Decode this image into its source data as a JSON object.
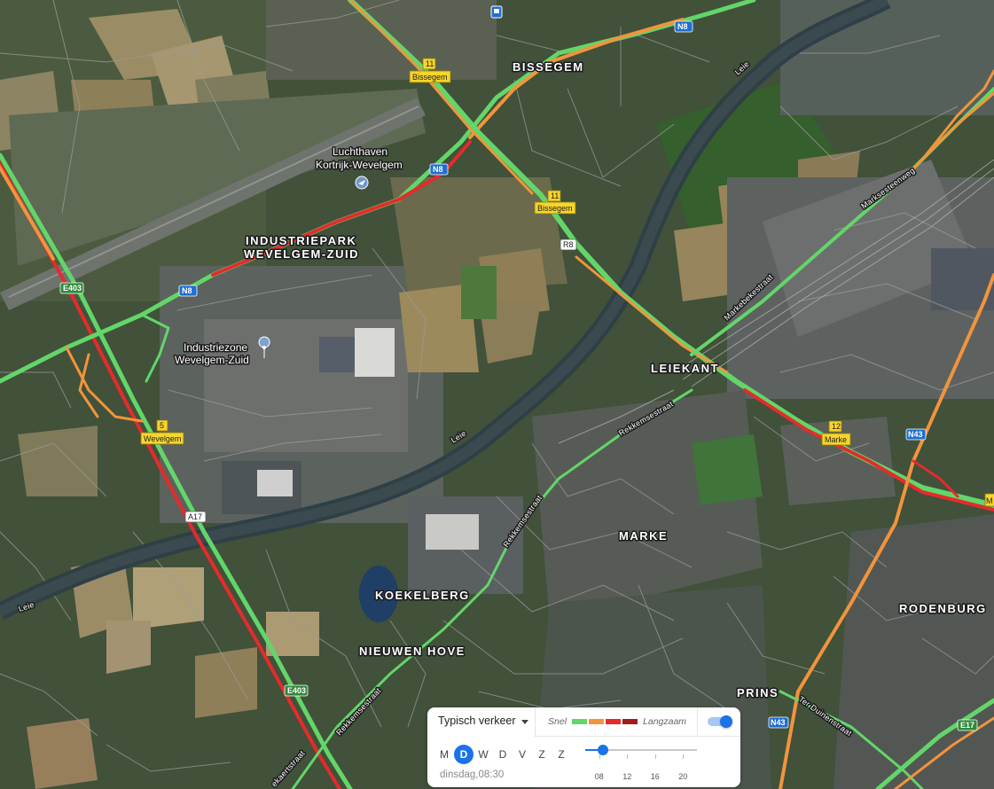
{
  "map": {
    "place_labels": {
      "bissegem": "BISSEGEM",
      "industriepark_1": "INDUSTRIEPARK",
      "industriepark_2": "WEVELGEM-ZUID",
      "leiekant": "LEIEKANT",
      "marke": "MARKE",
      "koekelberg": "KOEKELBERG",
      "nieuwen_hove": "NIEUWEN HOVE",
      "rodenburg": "RODENBURG",
      "prins": "PRINS"
    },
    "poi_labels": {
      "airport_1": "Luchthaven",
      "airport_2": "Kortrijk-Wevelgem",
      "industriezone_1": "Industriezone",
      "industriezone_2": "Wevelgem-Zuid"
    },
    "water_labels": {
      "leie_1": "Leie",
      "leie_2": "Leie",
      "leie_3": "Leie"
    },
    "street_labels": {
      "markebekestraat": "Markebekestraat",
      "marksesteenweg": "Marksesteenweg",
      "rekkemsestraat_1": "Rekkemsestraat",
      "rekkemsestraat_2": "Rekkemsestraat",
      "rekkemsestraat_3": "Rekkemsestraat",
      "ter_duinenstraat": "Ter Duinenstraat",
      "bottom_street": "ekaertstraat"
    },
    "shields": {
      "n8_a": "N8",
      "n8_b": "N8",
      "n8_c": "N8",
      "e403_a": "E403",
      "e403_b": "E403",
      "a17": "A17",
      "r8": "R8",
      "n43_a": "N43",
      "n43_b": "N43",
      "e17": "E17",
      "exit_11_a_num": "11",
      "exit_11_a_name": "Bissegem",
      "exit_11_b_num": "11",
      "exit_11_b_name": "Bissegem",
      "exit_5_num": "5",
      "exit_5_name": "Wevelgem",
      "exit_12_num": "12",
      "exit_12_name": "Marke",
      "exit_m": "M"
    },
    "colors": {
      "fast": "#63d66a",
      "medium": "#f2943c",
      "slow": "#e52b2b",
      "very_slow": "#a11d1d"
    }
  },
  "traffic": {
    "mode_label": "Typisch verkeer",
    "legend_fast": "Snel",
    "legend_slow": "Langzaam",
    "toggle_on": true,
    "days": [
      "M",
      "D",
      "W",
      "D",
      "V",
      "Z",
      "Z"
    ],
    "active_day_index": 1,
    "day_time": "dinsdag,08:30",
    "slider": {
      "hour_min": 6,
      "hour_max": 22,
      "value_hour": 8.5,
      "tick_labels": [
        "08",
        "12",
        "16",
        "20"
      ],
      "tick_hours": [
        8,
        12,
        16,
        20
      ]
    }
  }
}
